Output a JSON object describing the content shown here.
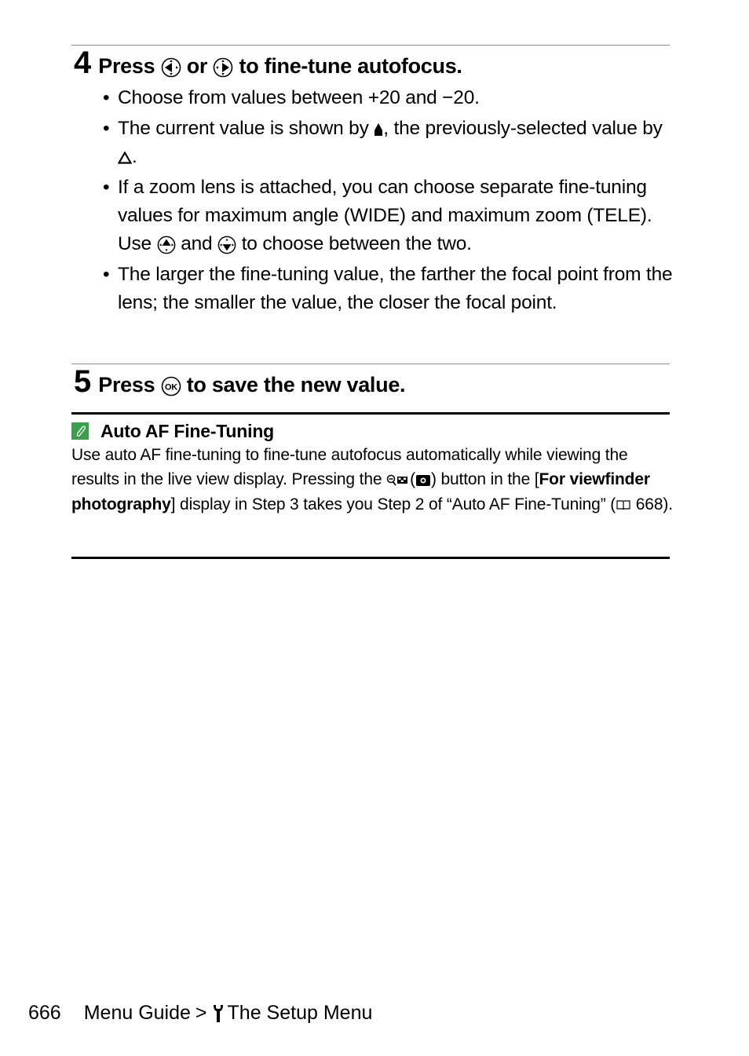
{
  "step4": {
    "number": "4",
    "title_press": "Press",
    "title_or": "or",
    "title_rest": "to fine-tune autofocus.",
    "icons": [
      "multi-selector-left-icon",
      "multi-selector-right-icon"
    ],
    "bullets": [
      {
        "text": "Choose from values between +20 and −20."
      },
      {
        "text_a": "The current value is shown by",
        "icon": "current-value-marker-icon",
        "text_b": ", the previously-selected value by",
        "icon2": "previous-value-marker-icon",
        "text_c": "."
      },
      {
        "text_a": "If a zoom lens is attached, you can choose separate fine-tuning values for maximum angle (WIDE) and maximum zoom (TELE). Use",
        "icon": "multi-selector-up-icon",
        "text_b": "and",
        "icon2": "multi-selector-down-icon",
        "text_c": "to choose between the two."
      },
      {
        "text": "The larger the fine-tuning value, the farther the focal point from the lens; the smaller the value, the closer the focal point."
      }
    ]
  },
  "step5": {
    "number": "5",
    "title_press": "Press",
    "icon": "ok-button-icon",
    "title_rest": "to save the new value."
  },
  "note": {
    "icon": "pencil-note-icon",
    "icon_color": "#3aa04a",
    "title": "Auto AF Fine-Tuning",
    "p1": "Use auto AF fine-tuning to fine-tune autofocus automatically while viewing the results in the live view display. Pressing the",
    "p2": "(",
    "p3": ") button in the [",
    "bold": "For viewfinder photography",
    "p4": "] display in Step 3 takes you Step 2 of “Auto AF Fine-Tuning” (",
    "page_ref": "668",
    "p5": ")."
  },
  "footer": {
    "page_number": "666",
    "section": "Menu Guide",
    "separator": ">",
    "menu": "The Setup Menu"
  }
}
